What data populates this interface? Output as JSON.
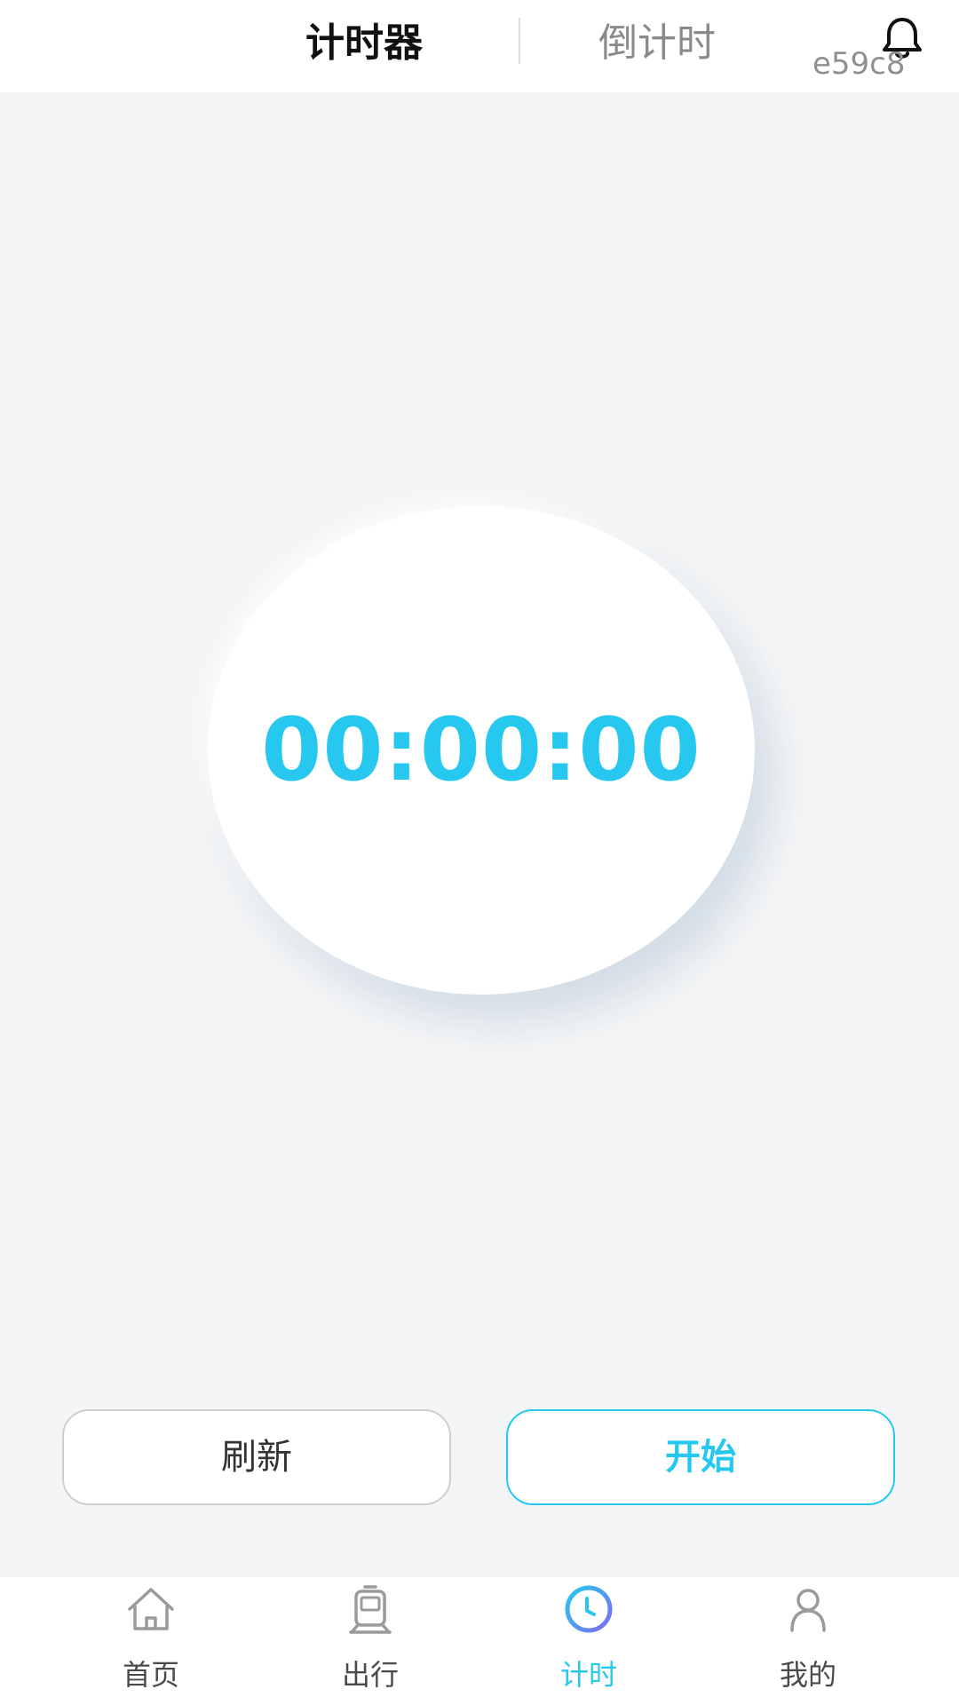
{
  "header": {
    "tabs": [
      {
        "label": "计时器",
        "active": true
      },
      {
        "label": "倒计时",
        "active": false
      }
    ],
    "bell_icon": "bell-icon",
    "watermark": "e59c8"
  },
  "timer": {
    "display": "00:00:00"
  },
  "buttons": {
    "refresh_label": "刷新",
    "start_label": "开始"
  },
  "nav": {
    "items": [
      {
        "label": "首页",
        "icon": "home-icon",
        "active": false
      },
      {
        "label": "出行",
        "icon": "train-icon",
        "active": false
      },
      {
        "label": "计时",
        "icon": "clock-icon",
        "active": true
      },
      {
        "label": "我的",
        "icon": "user-icon",
        "active": false
      }
    ]
  },
  "colors": {
    "accent": "#27c8f0",
    "background": "#f4f5f6",
    "text_primary": "#111111",
    "text_muted": "#8a8a8a"
  }
}
